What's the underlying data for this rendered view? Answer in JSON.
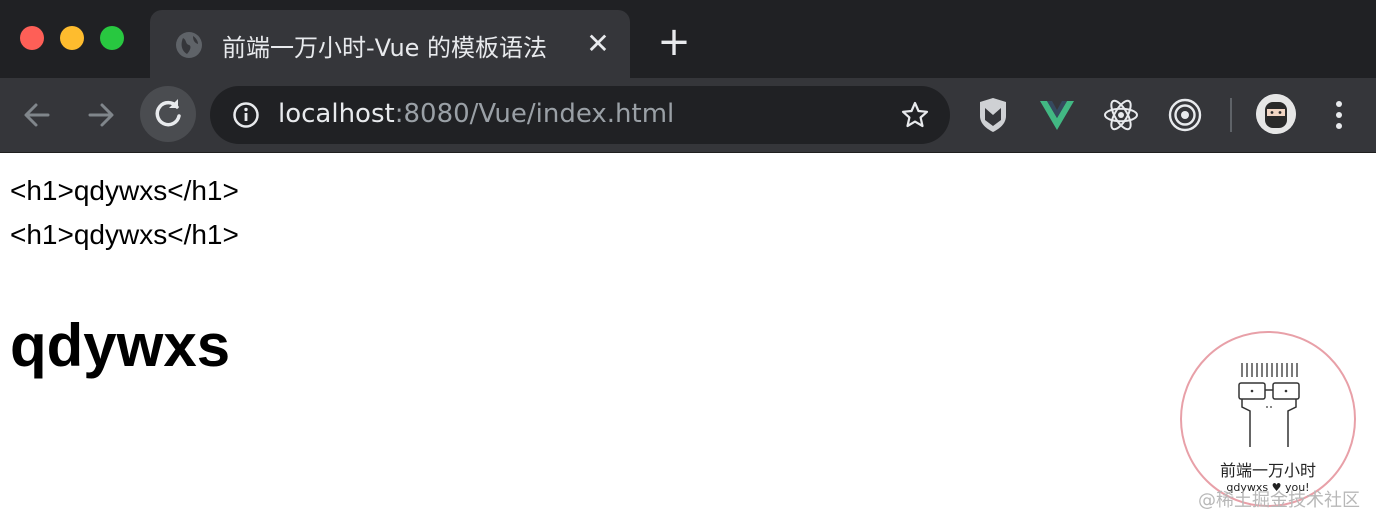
{
  "tab": {
    "title": "前端一万小时-Vue 的模板语法",
    "close_glyph": "✕"
  },
  "new_tab_glyph": "+",
  "omnibox": {
    "host": "localhost",
    "rest": ":8080/Vue/index.html"
  },
  "page": {
    "raw_lines": [
      "<h1>qdywxs</h1>",
      "<h1>qdywxs</h1>"
    ],
    "heading": "qdywxs"
  },
  "watermark": {
    "brand": "前端一万小时",
    "sub": "qdywxs ♥ you!",
    "site": "@稀土掘金技术社区"
  },
  "icons": {
    "traffic": [
      "close-light",
      "minimize-light",
      "maximize-light"
    ],
    "toolbar": [
      "back-arrow-icon",
      "forward-arrow-icon",
      "reload-icon",
      "info-icon",
      "star-icon"
    ],
    "extensions": [
      "shield-m-icon",
      "vue-icon",
      "react-icon",
      "target-icon"
    ],
    "menu": "kebab-menu-icon"
  },
  "colors": {
    "tabstrip": "#202124",
    "toolbar": "#35363a",
    "omnibox": "#202124",
    "vue_green": "#42b883"
  }
}
